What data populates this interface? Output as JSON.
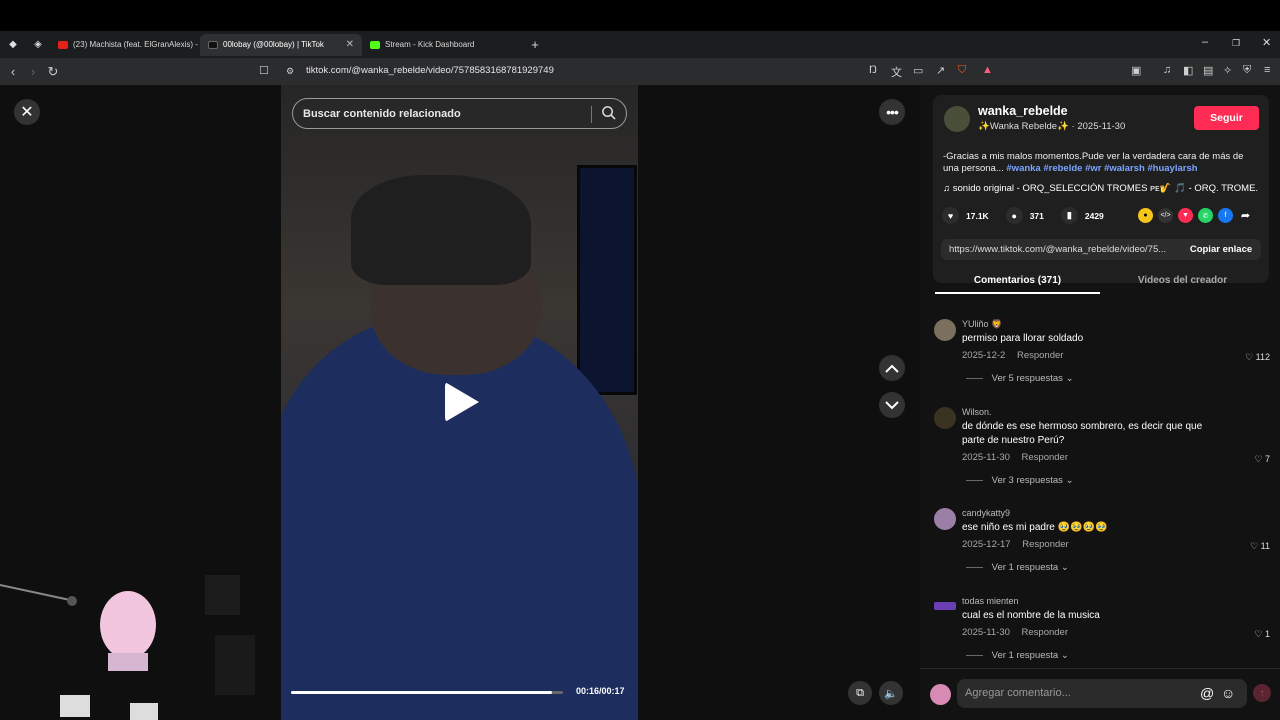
{
  "browser": {
    "tabs": [
      {
        "title": "(23) Machista (feat. ElGranAlexis) - Y",
        "favicon_color": "#e62117",
        "active": false
      },
      {
        "title": "00lobay (@00lobay) | TikTok",
        "favicon_color": "#111111",
        "active": true
      },
      {
        "title": "Stream - Kick Dashboard",
        "favicon_color": "#53fc18",
        "active": false
      }
    ],
    "url": "tiktok.com/@wanka_rebelde/video/7578583168781929749",
    "new_tab_icon": "+",
    "window_controls": [
      "–",
      "❐",
      "✕"
    ]
  },
  "search": {
    "placeholder": "Buscar contenido relacionado"
  },
  "player": {
    "time": "00:16/00:17",
    "progress": 0.96
  },
  "post": {
    "username": "wanka_rebelde",
    "nickname": "✨Wanka Rebelde✨",
    "date": "2025-11-30",
    "follow_label": "Seguir",
    "description": "-Gracias a mis malos momentos.Pude ver la verdadera cara de más de una persona...",
    "hashtags": "#wanka #rebelde #wr #walarsh #huaylarsh",
    "sound": "sonido original - ORQ_SELECCIÓN TROMES ᴘᴇ🎷 🎵 - ORQ. TROME...",
    "likes": "17.1K",
    "comments_count": "371",
    "saves": "2429",
    "link": "https://www.tiktok.com/@wanka_rebelde/video/75...",
    "copy_label": "Copiar enlace"
  },
  "tabs": {
    "comments": "Comentarios (371)",
    "creator_videos": "Videos del creador"
  },
  "comments": [
    {
      "user": "YUliño 🦁",
      "text": "permiso para llorar soldado",
      "date": "2025-12-2",
      "reply": "Responder",
      "likes": "112",
      "replies": "Ver 5 respuestas",
      "avatar_color": "#7b6f5e"
    },
    {
      "user": "Wilson.",
      "text": "de dónde es ese hermoso sombrero, es decir que que parte de nuestro Perú?",
      "date": "2025-11-30",
      "reply": "Responder",
      "likes": "7",
      "replies": "Ver 3 respuestas",
      "avatar_color": "#3a3322"
    },
    {
      "user": "candykatty9",
      "text": "ese niño es mi padre 🥹🥹🥹🥹",
      "date": "2025-12-17",
      "reply": "Responder",
      "likes": "11",
      "replies": "Ver 1 respuesta",
      "avatar_color": "#9c7fa6"
    },
    {
      "user": "todas mienten",
      "text": "cual es el nombre de la musica",
      "date": "2025-11-30",
      "reply": "Responder",
      "likes": "1",
      "replies": "Ver 1 respuesta",
      "avatar_color": "#6a3fb5"
    }
  ],
  "comment_input": {
    "placeholder": "Agregar comentario..."
  }
}
